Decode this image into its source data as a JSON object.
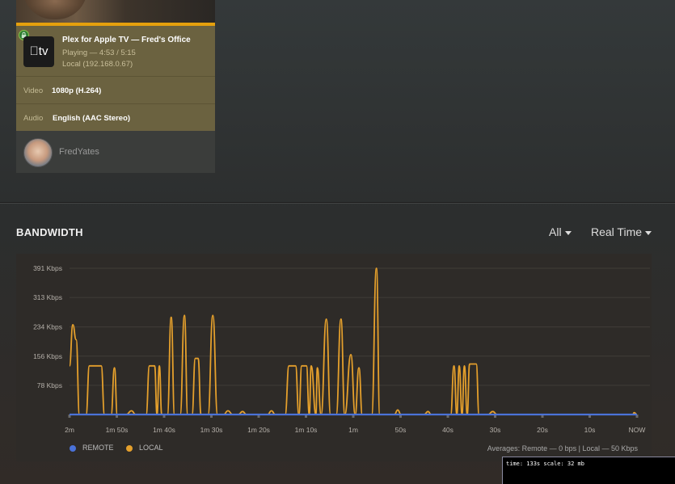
{
  "session": {
    "progress_fraction": 1.0,
    "player_title": "Plex for Apple TV  —  Fred's Office",
    "device_icon_label": "tv",
    "status": "Playing — 4:53 / 5:15",
    "location": "Local (192.168.0.67)",
    "video_label": "Video",
    "video_value": "1080p (H.264)",
    "audio_label": "Audio",
    "audio_value": "English (AAC Stereo)",
    "username": "FredYates"
  },
  "bandwidth": {
    "title": "BANDWIDTH",
    "filter_label": "All",
    "range_label": "Real Time",
    "legend_remote": "REMOTE",
    "legend_local": "LOCAL",
    "averages": "Averages: Remote — 0 bps | Local — 50 Kbps",
    "colors": {
      "remote": "#4a72d8",
      "local": "#e5a02c"
    }
  },
  "debug": {
    "text": "time: 133s  scale: 32 mb"
  },
  "chart_data": {
    "type": "line",
    "xlabel": "",
    "ylabel": "",
    "ytick_labels": [
      "391 Kbps",
      "313 Kbps",
      "234 Kbps",
      "156 Kbps",
      "78 Kbps"
    ],
    "ytick_values": [
      391,
      313,
      234,
      156,
      78
    ],
    "ylim": [
      0,
      391
    ],
    "xtick_labels": [
      "2m",
      "1m 50s",
      "1m 40s",
      "1m 30s",
      "1m 20s",
      "1m 10s",
      "1m",
      "50s",
      "40s",
      "30s",
      "20s",
      "10s",
      "NOW"
    ],
    "x_unit": "seconds before now",
    "xlim": [
      120,
      0
    ],
    "grid": true,
    "legend_position": "bottom-left",
    "series": [
      {
        "name": "REMOTE",
        "points": [
          [
            120,
            0
          ],
          [
            0,
            0
          ]
        ]
      },
      {
        "name": "LOCAL",
        "points": [
          [
            120,
            130
          ],
          [
            119.3,
            240
          ],
          [
            118.6,
            200
          ],
          [
            117.9,
            0
          ],
          [
            116.5,
            0
          ],
          [
            115.8,
            130
          ],
          [
            114.6,
            130
          ],
          [
            113.3,
            130
          ],
          [
            112.6,
            0
          ],
          [
            111.2,
            0
          ],
          [
            110.5,
            125
          ],
          [
            109.9,
            0
          ],
          [
            108,
            0
          ],
          [
            106.9,
            10
          ],
          [
            106,
            0
          ],
          [
            103.8,
            0
          ],
          [
            103.1,
            130
          ],
          [
            102,
            130
          ],
          [
            101.5,
            0
          ],
          [
            101,
            130
          ],
          [
            100.5,
            0
          ],
          [
            99.3,
            0
          ],
          [
            98.5,
            260
          ],
          [
            97.8,
            0
          ],
          [
            96.6,
            0
          ],
          [
            95.7,
            265
          ],
          [
            95,
            0
          ],
          [
            94.1,
            0
          ],
          [
            93.4,
            150
          ],
          [
            92.8,
            150
          ],
          [
            92.2,
            0
          ],
          [
            90.7,
            0
          ],
          [
            89.7,
            265
          ],
          [
            88.7,
            0
          ],
          [
            87.4,
            0
          ],
          [
            86.5,
            10
          ],
          [
            85.5,
            0
          ],
          [
            84.3,
            0
          ],
          [
            83.4,
            8
          ],
          [
            82.6,
            0
          ],
          [
            78.1,
            0
          ],
          [
            77.3,
            10
          ],
          [
            76.5,
            0
          ],
          [
            74.4,
            0
          ],
          [
            73.6,
            130
          ],
          [
            72.2,
            130
          ],
          [
            71.5,
            0
          ],
          [
            70.9,
            130
          ],
          [
            69.9,
            130
          ],
          [
            69.3,
            0
          ],
          [
            68.9,
            130
          ],
          [
            67.9,
            0
          ],
          [
            67.6,
            125
          ],
          [
            66.8,
            0
          ],
          [
            65.7,
            255
          ],
          [
            64.8,
            0
          ],
          [
            63.6,
            0
          ],
          [
            62.6,
            255
          ],
          [
            61.8,
            0
          ],
          [
            60.5,
            160
          ],
          [
            59.6,
            0
          ],
          [
            58.8,
            125
          ],
          [
            58.1,
            0
          ],
          [
            56.1,
            0
          ],
          [
            55.1,
            391
          ],
          [
            54.4,
            0
          ],
          [
            51.3,
            0
          ],
          [
            50.6,
            12
          ],
          [
            49.9,
            0
          ],
          [
            45,
            0
          ],
          [
            44.2,
            8
          ],
          [
            43.5,
            0
          ],
          [
            39.4,
            0
          ],
          [
            38.7,
            130
          ],
          [
            38.1,
            0
          ],
          [
            37.6,
            130
          ],
          [
            37,
            0
          ],
          [
            36.5,
            130
          ],
          [
            35.9,
            0
          ],
          [
            35.4,
            135
          ],
          [
            34,
            135
          ],
          [
            33.4,
            0
          ],
          [
            31.5,
            0
          ],
          [
            30.5,
            8
          ],
          [
            29.6,
            0
          ],
          [
            0.9,
            0
          ],
          [
            0.6,
            5
          ],
          [
            0,
            0
          ]
        ]
      }
    ]
  }
}
